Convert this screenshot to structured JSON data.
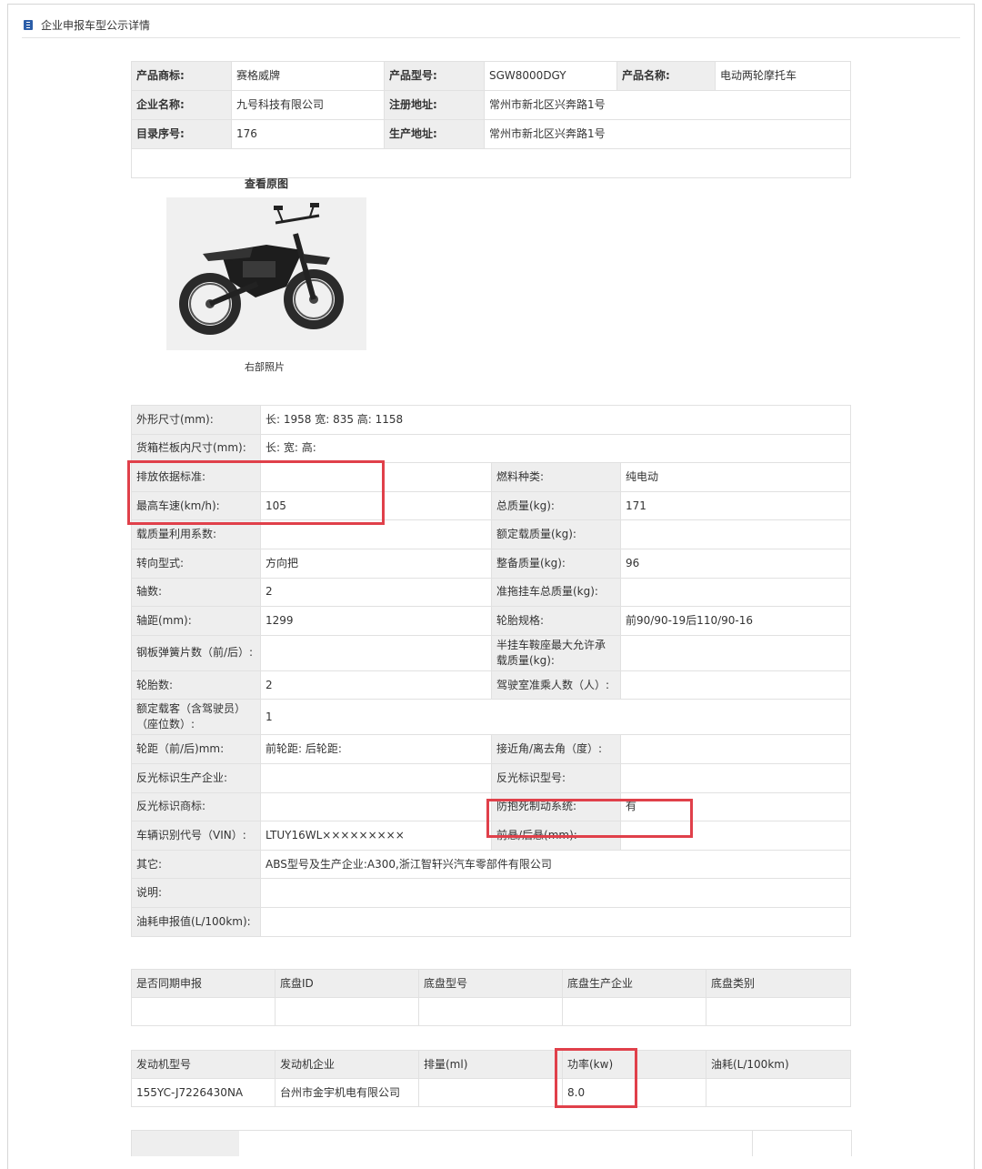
{
  "header": {
    "title": "企业申报车型公示详情"
  },
  "basic": {
    "rows": [
      [
        {
          "label": "产品商标:",
          "value": "赛格威牌"
        },
        {
          "label": "产品型号:",
          "value": "SGW8000DGY"
        },
        {
          "label": "产品名称:",
          "value": "电动两轮摩托车"
        }
      ],
      [
        {
          "label": "企业名称:",
          "value": "九号科技有限公司"
        },
        {
          "label": "注册地址:",
          "value": "常州市新北区兴奔路1号"
        }
      ],
      [
        {
          "label": "目录序号:",
          "value": "176"
        },
        {
          "label": "生产地址:",
          "value": "常州市新北区兴奔路1号"
        }
      ]
    ]
  },
  "photo": {
    "link_label": "查看原图",
    "caption": "右部照片"
  },
  "params": {
    "outline": {
      "label": "外形尺寸(mm):",
      "value": "长: 1958 宽: 835 高: 1158"
    },
    "cargo": {
      "label": "货箱栏板内尺寸(mm):",
      "value": "长:  宽:  高:"
    },
    "pairs": [
      {
        "l1": "排放依据标准:",
        "v1": "",
        "l2": "燃料种类:",
        "v2": "纯电动"
      },
      {
        "l1": "最高车速(km/h):",
        "v1": "105",
        "l2": "总质量(kg):",
        "v2": "171"
      },
      {
        "l1": "载质量利用系数:",
        "v1": "",
        "l2": "额定载质量(kg):",
        "v2": ""
      },
      {
        "l1": "转向型式:",
        "v1": "方向把",
        "l2": "整备质量(kg):",
        "v2": "96"
      },
      {
        "l1": "轴数:",
        "v1": "2",
        "l2": "准拖挂车总质量(kg):",
        "v2": ""
      },
      {
        "l1": "轴距(mm):",
        "v1": "1299",
        "l2": "轮胎规格:",
        "v2": "前90/90-19后110/90-16"
      },
      {
        "l1": "钢板弹簧片数（前/后）:",
        "v1": "",
        "l2": "半挂车鞍座最大允许承载质量(kg):",
        "v2": ""
      },
      {
        "l1": "轮胎数:",
        "v1": "2",
        "l2": "驾驶室准乘人数（人）:",
        "v2": ""
      }
    ],
    "seats": {
      "label": "额定载客（含驾驶员）（座位数）:",
      "value": "1"
    },
    "pairs2": [
      {
        "l1": "轮距（前/后)mm:",
        "v1": "前轮距: 后轮距:",
        "l2": "接近角/离去角（度）:",
        "v2": ""
      },
      {
        "l1": "反光标识生产企业:",
        "v1": "",
        "l2": "反光标识型号:",
        "v2": ""
      },
      {
        "l1": "反光标识商标:",
        "v1": "",
        "l2": "防抱死制动系统:",
        "v2": "有"
      },
      {
        "l1": "车辆识别代号（VIN）:",
        "v1": "LTUY16WL×××××××××",
        "l2": "前悬/后悬(mm):",
        "v2": ""
      }
    ],
    "other": {
      "label": "其它:",
      "value": "ABS型号及生产企业:A300,浙江智轩兴汽车零部件有限公司"
    },
    "note": {
      "label": "说明:",
      "value": ""
    },
    "fuel": {
      "label": "油耗申报值(L/100km):",
      "value": ""
    }
  },
  "chassis": {
    "headers": [
      "是否同期申报",
      "底盘ID",
      "底盘型号",
      "底盘生产企业",
      "底盘类别"
    ],
    "row": [
      "",
      "",
      "",
      "",
      ""
    ]
  },
  "engine": {
    "headers": [
      "发动机型号",
      "发动机企业",
      "排量(ml)",
      "功率(kw)",
      "油耗(L/100km)"
    ],
    "row": [
      "155YC-J7226430NA",
      "台州市金宇机电有限公司",
      "",
      "8.0",
      ""
    ]
  },
  "colors": {
    "highlight": "#e0404a",
    "label_bg": "#eeeeee",
    "icon": "#2b5da8"
  }
}
